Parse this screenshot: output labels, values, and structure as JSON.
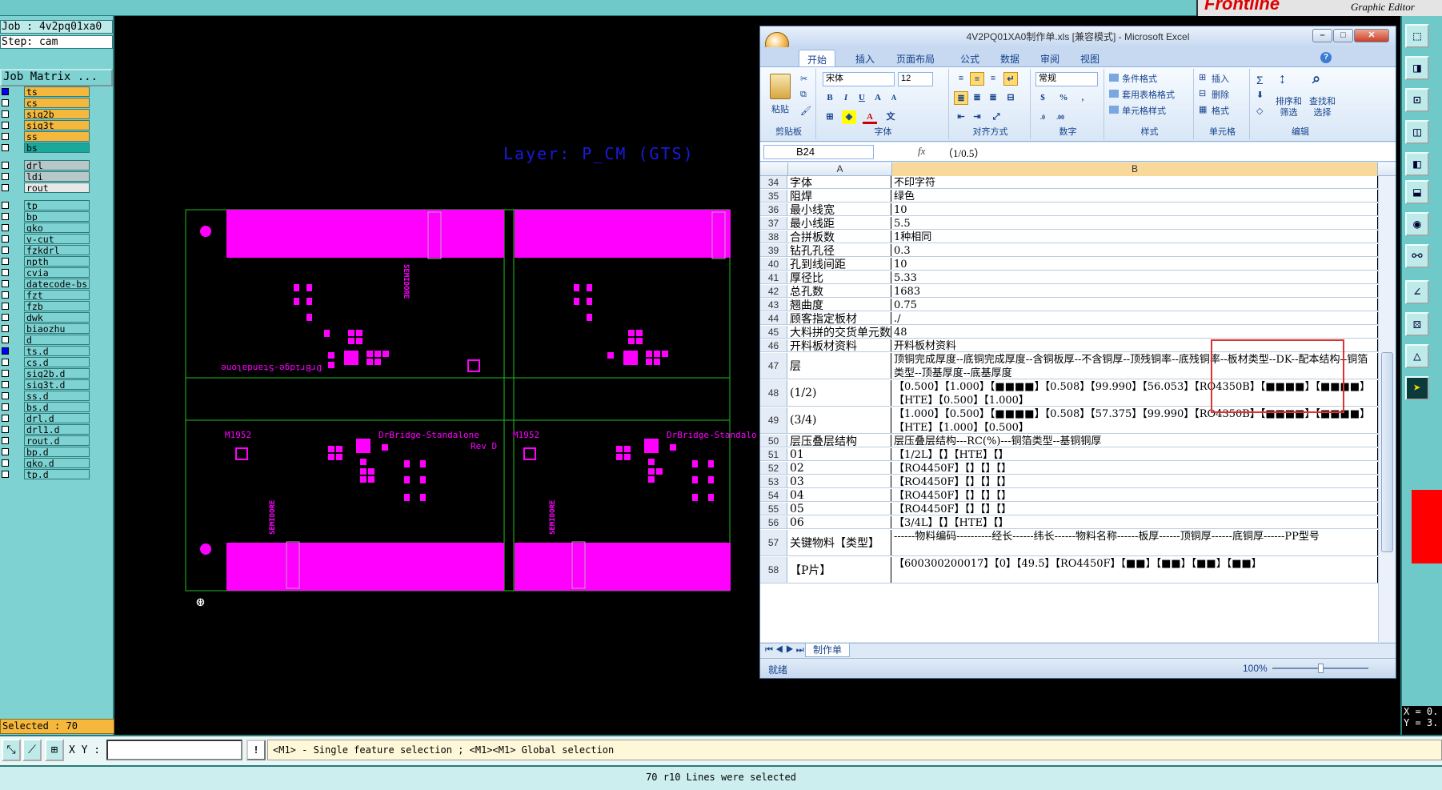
{
  "app": {
    "brand": "Frontline",
    "subtitle": "Graphic Editor"
  },
  "left_panel": {
    "job": "Job : 4v2pq01xa0",
    "step": "Step: cam",
    "job_matrix": "Job Matrix ...",
    "layers": [
      {
        "name": "ts",
        "color": "#f5b83d",
        "mark": "⊞",
        "chk": "blue"
      },
      {
        "name": "cs",
        "color": "#f5b83d",
        "mark": "◢"
      },
      {
        "name": "sig2b",
        "color": "#f5b83d",
        "mark": ""
      },
      {
        "name": "sig3t",
        "color": "#f5b83d",
        "mark": ""
      },
      {
        "name": "ss",
        "color": "#f5b83d",
        "mark": "◢"
      },
      {
        "name": "bs",
        "color": "#1aa89a",
        "mark": ""
      },
      {
        "name": "drl",
        "color": "#b8c8c8",
        "mark": ""
      },
      {
        "name": "ldi",
        "color": "#b8c8c8",
        "mark": ""
      },
      {
        "name": "rout",
        "color": "#e8e8e8",
        "mark": ""
      },
      {
        "name": "tp",
        "color": "#7fd2d2",
        "mark": ""
      },
      {
        "name": "bp",
        "color": "#7fd2d2",
        "mark": ""
      },
      {
        "name": "gko",
        "color": "#7fd2d2",
        "mark": ""
      },
      {
        "name": "v-cut",
        "color": "#7fd2d2",
        "mark": ""
      },
      {
        "name": "fzkdrl",
        "color": "#7fd2d2",
        "mark": ""
      },
      {
        "name": "npth",
        "color": "#7fd2d2",
        "mark": ""
      },
      {
        "name": "cvia",
        "color": "#7fd2d2",
        "mark": ""
      },
      {
        "name": "datecode-bs",
        "color": "#7fd2d2",
        "mark": ""
      },
      {
        "name": "fzt",
        "color": "#7fd2d2",
        "mark": ""
      },
      {
        "name": "fzb",
        "color": "#7fd2d2",
        "mark": ""
      },
      {
        "name": "dwk",
        "color": "#7fd2d2",
        "mark": ""
      },
      {
        "name": "biaozhu",
        "color": "#7fd2d2",
        "mark": ""
      },
      {
        "name": "d",
        "color": "#7fd2d2",
        "mark": ""
      },
      {
        "name": "ts.d",
        "color": "#7fd2d2",
        "mark": "",
        "chk": "blue"
      },
      {
        "name": "cs.d",
        "color": "#7fd2d2",
        "mark": "◢"
      },
      {
        "name": "sig2b.d",
        "color": "#7fd2d2",
        "mark": ""
      },
      {
        "name": "sig3t.d",
        "color": "#7fd2d2",
        "mark": ""
      },
      {
        "name": "ss.d",
        "color": "#7fd2d2",
        "mark": "◢"
      },
      {
        "name": "bs.d",
        "color": "#7fd2d2",
        "mark": ""
      },
      {
        "name": "drl.d",
        "color": "#7fd2d2",
        "mark": ""
      },
      {
        "name": "drl1.d",
        "color": "#7fd2d2",
        "mark": ""
      },
      {
        "name": "rout.d",
        "color": "#7fd2d2",
        "mark": ""
      },
      {
        "name": "bp.d",
        "color": "#7fd2d2",
        "mark": ""
      },
      {
        "name": "gko.d",
        "color": "#7fd2d2",
        "mark": ""
      },
      {
        "name": "tp.d",
        "color": "#7fd2d2",
        "mark": ""
      }
    ],
    "selected": "Selected : 70"
  },
  "canvas": {
    "layer_label": "Layer: P_CM (GTS)",
    "pcb_texts": {
      "name": "DrBridge-Standalone",
      "rev": "Rev D",
      "code": "M1952",
      "brand": "SEMIDORE"
    }
  },
  "excel": {
    "title": "4V2PQ01XA0制作单.xls  [兼容模式]  - Microsoft Excel",
    "tabs": [
      "开始",
      "插入",
      "页面布局",
      "公式",
      "数据",
      "审阅",
      "视图"
    ],
    "active_tab": "开始",
    "ribbon": {
      "paste": "粘贴",
      "groups": [
        "剪贴板",
        "字体",
        "对齐方式",
        "数字",
        "样式",
        "单元格",
        "编辑"
      ],
      "font_name": "宋体",
      "font_size": "12",
      "number_format": "常规",
      "styles": [
        "条件格式",
        "套用表格格式",
        "单元格样式"
      ],
      "cells": [
        "插入",
        "删除",
        "格式"
      ],
      "edit": [
        "排序和\n筛选",
        "查找和\n选择"
      ],
      "percent": "%"
    },
    "name_box": "B24",
    "fx": "fx",
    "formula": "（1/0.5）",
    "col_a": "A",
    "col_b": "B",
    "rows": [
      {
        "n": "34",
        "a": "字体",
        "b": "不印字符",
        "h": 16
      },
      {
        "n": "35",
        "a": "阻焊",
        "b": "绿色",
        "h": 16
      },
      {
        "n": "36",
        "a": "最小线宽",
        "b": "10",
        "h": 16
      },
      {
        "n": "37",
        "a": "最小线距",
        "b": "5.5",
        "h": 16
      },
      {
        "n": "38",
        "a": "合拼板数",
        "b": "1种相同",
        "h": 16
      },
      {
        "n": "39",
        "a": "钻孔孔径",
        "b": "0.3",
        "h": 16
      },
      {
        "n": "40",
        "a": "孔到线间距",
        "b": "10",
        "h": 16
      },
      {
        "n": "41",
        "a": "厚径比",
        "b": "5.33",
        "h": 16
      },
      {
        "n": "42",
        "a": "总孔数",
        "b": "1683",
        "h": 16
      },
      {
        "n": "43",
        "a": "翘曲度",
        "b": "0.75",
        "h": 16
      },
      {
        "n": "44",
        "a": "顾客指定板材",
        "b": "./",
        "h": 16
      },
      {
        "n": "45",
        "a": "大料拼的交货单元数",
        "b": "48",
        "h": 16
      },
      {
        "n": "46",
        "a": "开料板材资料",
        "b": "开料板材资料",
        "h": 16
      },
      {
        "n": "47",
        "a": "层",
        "b": "顶铜完成厚度--底铜完成厚度--含铜板厚--不含铜厚--顶残铜率--底残铜率--板材类型--DK--配本结构--铜箔类型--顶基厚度--底基厚度",
        "h": 33
      },
      {
        "n": "48",
        "a": "(1/2)",
        "b": "【0.500】【1.000】【■■■■】【0.508】【99.990】【56.053】【RO4350B】【■■■■】【■■■■】【HTE】【0.500】【1.000】",
        "h": 33
      },
      {
        "n": "49",
        "a": "(3/4)",
        "b": "【1.000】【0.500】【■■■■】【0.508】【57.375】【99.990】【RO4350B】【■■■■】【■■■■】【HTE】【1.000】【0.500】",
        "h": 33
      },
      {
        "n": "50",
        "a": "层压叠层结构",
        "b": "层压叠层结构---RC(%)---铜箔类型--基铜铜厚",
        "h": 16
      },
      {
        "n": "51",
        "a": "01",
        "b": "【1/2L】【】【HTE】【】",
        "h": 16
      },
      {
        "n": "52",
        "a": "02",
        "b": "【RO4450F】【】【】【】",
        "h": 16
      },
      {
        "n": "53",
        "a": "03",
        "b": "【RO4450F】【】【】【】",
        "h": 16
      },
      {
        "n": "54",
        "a": "04",
        "b": "【RO4450F】【】【】【】",
        "h": 16
      },
      {
        "n": "55",
        "a": "05",
        "b": "【RO4450F】【】【】【】",
        "h": 16
      },
      {
        "n": "56",
        "a": "06",
        "b": "【3/4L】【】【HTE】【】",
        "h": 16
      },
      {
        "n": "57",
        "a": "关键物料【类型】",
        "b": "------物料编码----------经长------纬长------物料名称------板厚------顶铜厚------底铜厚------PP型号",
        "h": 33
      },
      {
        "n": "58",
        "a": "【P片】",
        "b": "【600300200017】【0】【49.5】【RO4450F】【■■】【■■】【■■】【■■】",
        "h": 33
      }
    ],
    "sheet_tab": "制作单",
    "status": "就绪",
    "zoom": "100%"
  },
  "coords": {
    "x": "X = 0.",
    "y": "Y = 3."
  },
  "bottom": {
    "xy_label": "X Y :",
    "xy_value": "",
    "warn": "!",
    "message": "<M1> - Single feature selection ; <M1><M1> Global selection",
    "status": "70 r10 Lines were selected"
  }
}
